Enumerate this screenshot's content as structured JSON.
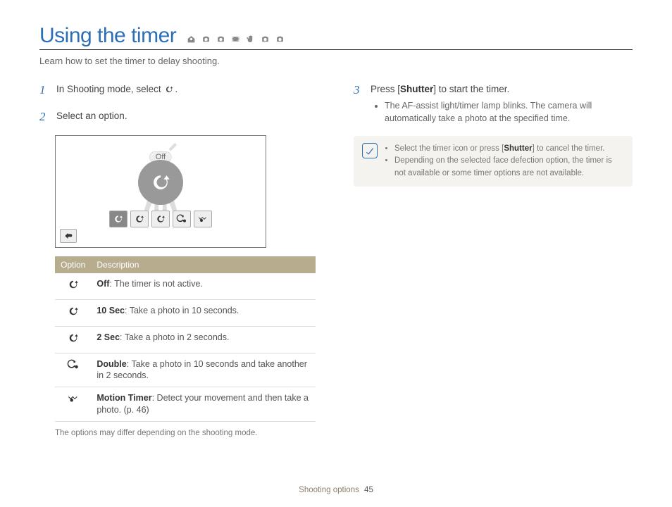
{
  "header": {
    "title": "Using the timer",
    "subtitle": "Learn how to set the timer to delay shooting."
  },
  "steps": {
    "s1_prefix": "In Shooting mode, select ",
    "s1_suffix": ".",
    "s2": "Select an option.",
    "s3_prefix": "Press [",
    "s3_bold": "Shutter",
    "s3_suffix": "] to start the timer.",
    "s3_bullet": "The AF-assist light/timer lamp blinks. The camera will automatically take a photo at the specified time."
  },
  "hub_label": "Off",
  "table": {
    "head_option": "Option",
    "head_desc": "Description",
    "rows": [
      {
        "bold": "Off",
        "rest": ": The timer is not active."
      },
      {
        "bold": "10 Sec",
        "rest": ": Take a photo in 10 seconds."
      },
      {
        "bold": "2 Sec",
        "rest": ": Take a photo in 2 seconds."
      },
      {
        "bold": "Double",
        "rest": ": Take a photo in 10 seconds and take another in 2 seconds."
      },
      {
        "bold": "Motion Timer",
        "rest": ": Detect your movement and then take a photo. (p. 46)"
      }
    ]
  },
  "foot_note": "The options may differ depending on the shooting mode.",
  "note": {
    "b1_pre": "Select the timer icon or press [",
    "b1_bold": "Shutter",
    "b1_post": "] to cancel the timer.",
    "b2": "Depending on the selected face defection option, the timer is not available or some timer options are not available."
  },
  "footer": {
    "section": "Shooting options",
    "page": "45"
  }
}
